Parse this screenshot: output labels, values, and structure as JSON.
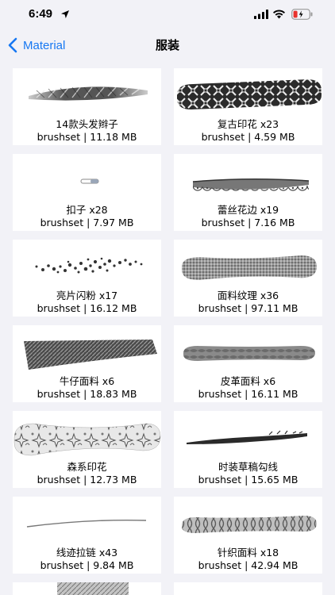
{
  "status_bar": {
    "time": "6:49"
  },
  "nav": {
    "back_label": "Material",
    "title": "服装"
  },
  "items": [
    {
      "name": "14款头发辫子",
      "meta": "brushset | 11.18 MB"
    },
    {
      "name": "复古印花 x23",
      "meta": "brushset | 4.59 MB"
    },
    {
      "name": "扣子 x28",
      "meta": "brushset | 7.97 MB"
    },
    {
      "name": "蕾丝花边 x19",
      "meta": "brushset | 7.16 MB"
    },
    {
      "name": "亮片闪粉 x17",
      "meta": "brushset | 16.12 MB"
    },
    {
      "name": "面料纹理 x36",
      "meta": "brushset | 97.11 MB"
    },
    {
      "name": "牛仔面料 x6",
      "meta": "brushset | 18.83 MB"
    },
    {
      "name": "皮革面料 x6",
      "meta": "brushset | 16.11 MB"
    },
    {
      "name": "森系印花",
      "meta": "brushset | 12.73 MB"
    },
    {
      "name": "时装草稿勾线",
      "meta": "brushset | 15.65 MB"
    },
    {
      "name": "线迹拉链 x43",
      "meta": "brushset | 9.84 MB"
    },
    {
      "name": "针织面料 x18",
      "meta": "brushset | 42.94 MB"
    }
  ],
  "colors": {
    "accent": "#1778f2",
    "background": "#f2f2f7",
    "card": "#ffffff",
    "battery_low": "#e8322d"
  },
  "icons": [
    "location-arrow-icon",
    "cellular-signal-icon",
    "wifi-icon",
    "battery-icon",
    "chevron-left-icon"
  ]
}
